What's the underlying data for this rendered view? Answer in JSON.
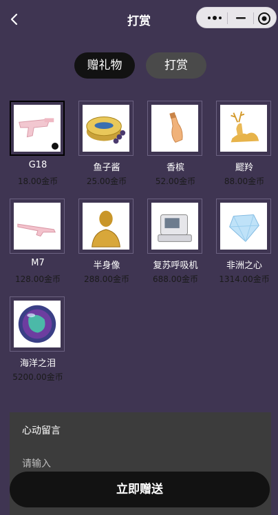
{
  "nav": {
    "title": "打赏"
  },
  "tabs": [
    {
      "label": "赠礼物",
      "active": true
    },
    {
      "label": "打赏",
      "active": false
    }
  ],
  "gifts": [
    {
      "name": "G18",
      "price": "18.00金币",
      "icon": "pistol",
      "selected": true
    },
    {
      "name": "鱼子酱",
      "price": "25.00金币",
      "icon": "caviar-tin"
    },
    {
      "name": "香槟",
      "price": "52.00金币",
      "icon": "champagne-bottle"
    },
    {
      "name": "飂羚",
      "price": "88.00金币",
      "icon": "golden-antelope"
    },
    {
      "name": "M7",
      "price": "128.00金币",
      "icon": "rifle"
    },
    {
      "name": "半身像",
      "price": "288.00金币",
      "icon": "golden-bust"
    },
    {
      "name": "复苏呼吸机",
      "price": "688.00金币",
      "icon": "ventilator"
    },
    {
      "name": "非洲之心",
      "price": "1314.00金币",
      "icon": "blue-diamond"
    },
    {
      "name": "海洋之泪",
      "price": "5200.00金币",
      "icon": "ocean-orb"
    }
  ],
  "message": {
    "label": "心动留言",
    "placeholder": "请输入"
  },
  "send_button": {
    "label": "立即赠送"
  },
  "colors": {
    "background": "#3f3552",
    "button": "#121212",
    "tab_inactive": "#4a4a4a"
  }
}
